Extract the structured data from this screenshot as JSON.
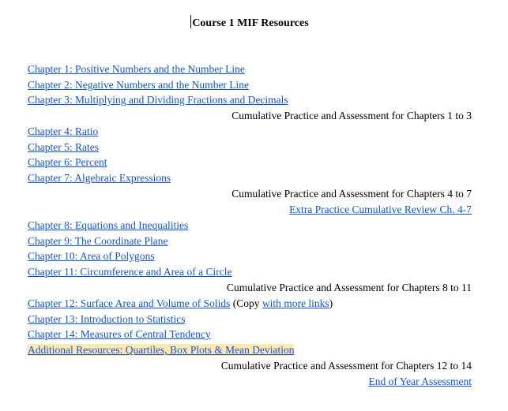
{
  "document": {
    "title": "Course 1 MIF Resources",
    "lines": [
      {
        "type": "link",
        "text": "Chapter 1: Positive Numbers and the Number Line"
      },
      {
        "type": "link",
        "text": "Chapter 2: Negative Numbers and the Number Line"
      },
      {
        "type": "link",
        "text": "Chapter 3: Multiplying and Dividing Fractions and Decimals"
      },
      {
        "type": "text",
        "text": "Cumulative Practice and Assessment for Chapters 1 to 3"
      },
      {
        "type": "link",
        "text": "Chapter 4: Ratio"
      },
      {
        "type": "link",
        "text": "Chapter 5: Rates"
      },
      {
        "type": "link",
        "text": "Chapter 6: Percent"
      },
      {
        "type": "link",
        "text": "Chapter 7: Algebraic Expressions"
      },
      {
        "type": "text",
        "text": "Cumulative Practice and Assessment for Chapters 4 to 7"
      },
      {
        "type": "link",
        "text": "Extra Practice Cumulative Review Ch. 4-7"
      },
      {
        "type": "link",
        "text": "Chapter 8: Equations and Inequalities"
      },
      {
        "type": "link",
        "text": "Chapter 9: The Coordinate Plane"
      },
      {
        "type": "link",
        "text": "Chapter 10: Area of Polygons"
      },
      {
        "type": "link",
        "text": "Chapter 11: Circumference and Area of a Circle"
      },
      {
        "type": "text",
        "text": "Cumulative Practice and Assessment for Chapters 8 to 11"
      },
      {
        "type": "mixed",
        "link1": "Chapter 12: Surface Area and Volume of Solids",
        "middle": " (Copy ",
        "link2": "with more links",
        "end": ")"
      },
      {
        "type": "link",
        "text": "Chapter 13: Introduction to Statistics"
      },
      {
        "type": "link",
        "text": "Chapter 14: Measures of Central Tendency"
      },
      {
        "type": "link",
        "text": "Additional Resources: Quartiles, Box Plots & Mean Deviation"
      },
      {
        "type": "text",
        "text": "Cumulative Practice and Assessment for Chapters 12 to 14"
      },
      {
        "type": "link",
        "text": "End of Year Assessment"
      }
    ]
  },
  "colors": {
    "link": "#1155cc",
    "highlight": "#fce8b2"
  }
}
